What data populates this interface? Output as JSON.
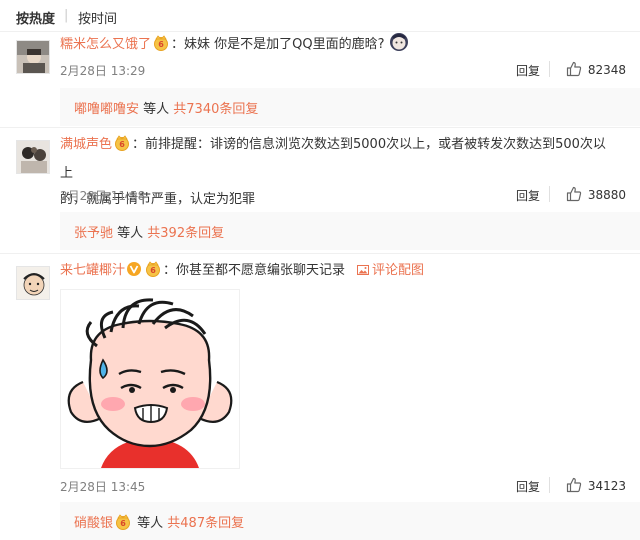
{
  "sort": {
    "hot": "按热度",
    "separator": "|",
    "time": "按时间"
  },
  "actions": {
    "reply": "回复"
  },
  "comments": [
    {
      "user": "糯米怎么又饿了",
      "content": "：妹妹 你是不是加了QQ里面的鹿晗?",
      "date": "2月28日 13:29",
      "likes": "82348",
      "reply_user": "嘟噜嘟噜安",
      "reply_mid": " 等人 ",
      "reply_count": "共7340条回复"
    },
    {
      "user": "满城声色",
      "content_line1": "：前排提醒：诽谤的信息浏览次数达到5000次以上，或者被转发次数达到500次以上",
      "content_line2": "的，就属于情节严重，认定为犯罪",
      "date": "2月28日 11:58",
      "likes": "38880",
      "reply_user": "张予驰",
      "reply_mid": " 等人 ",
      "reply_count": "共392条回复"
    },
    {
      "user": "来七罐椰汁",
      "content": "：你甚至都不愿意编张聊天记录",
      "review_link": "评论配图",
      "date": "2月28日 13:45",
      "likes": "34123",
      "reply_user": "硝酸银",
      "reply_mid": " 等人 ",
      "reply_count": "共487条回复"
    }
  ],
  "colors": {
    "username": "#eb7350",
    "text": "#333333",
    "meta": "#808080",
    "reply_bg": "#f9f9f9"
  }
}
